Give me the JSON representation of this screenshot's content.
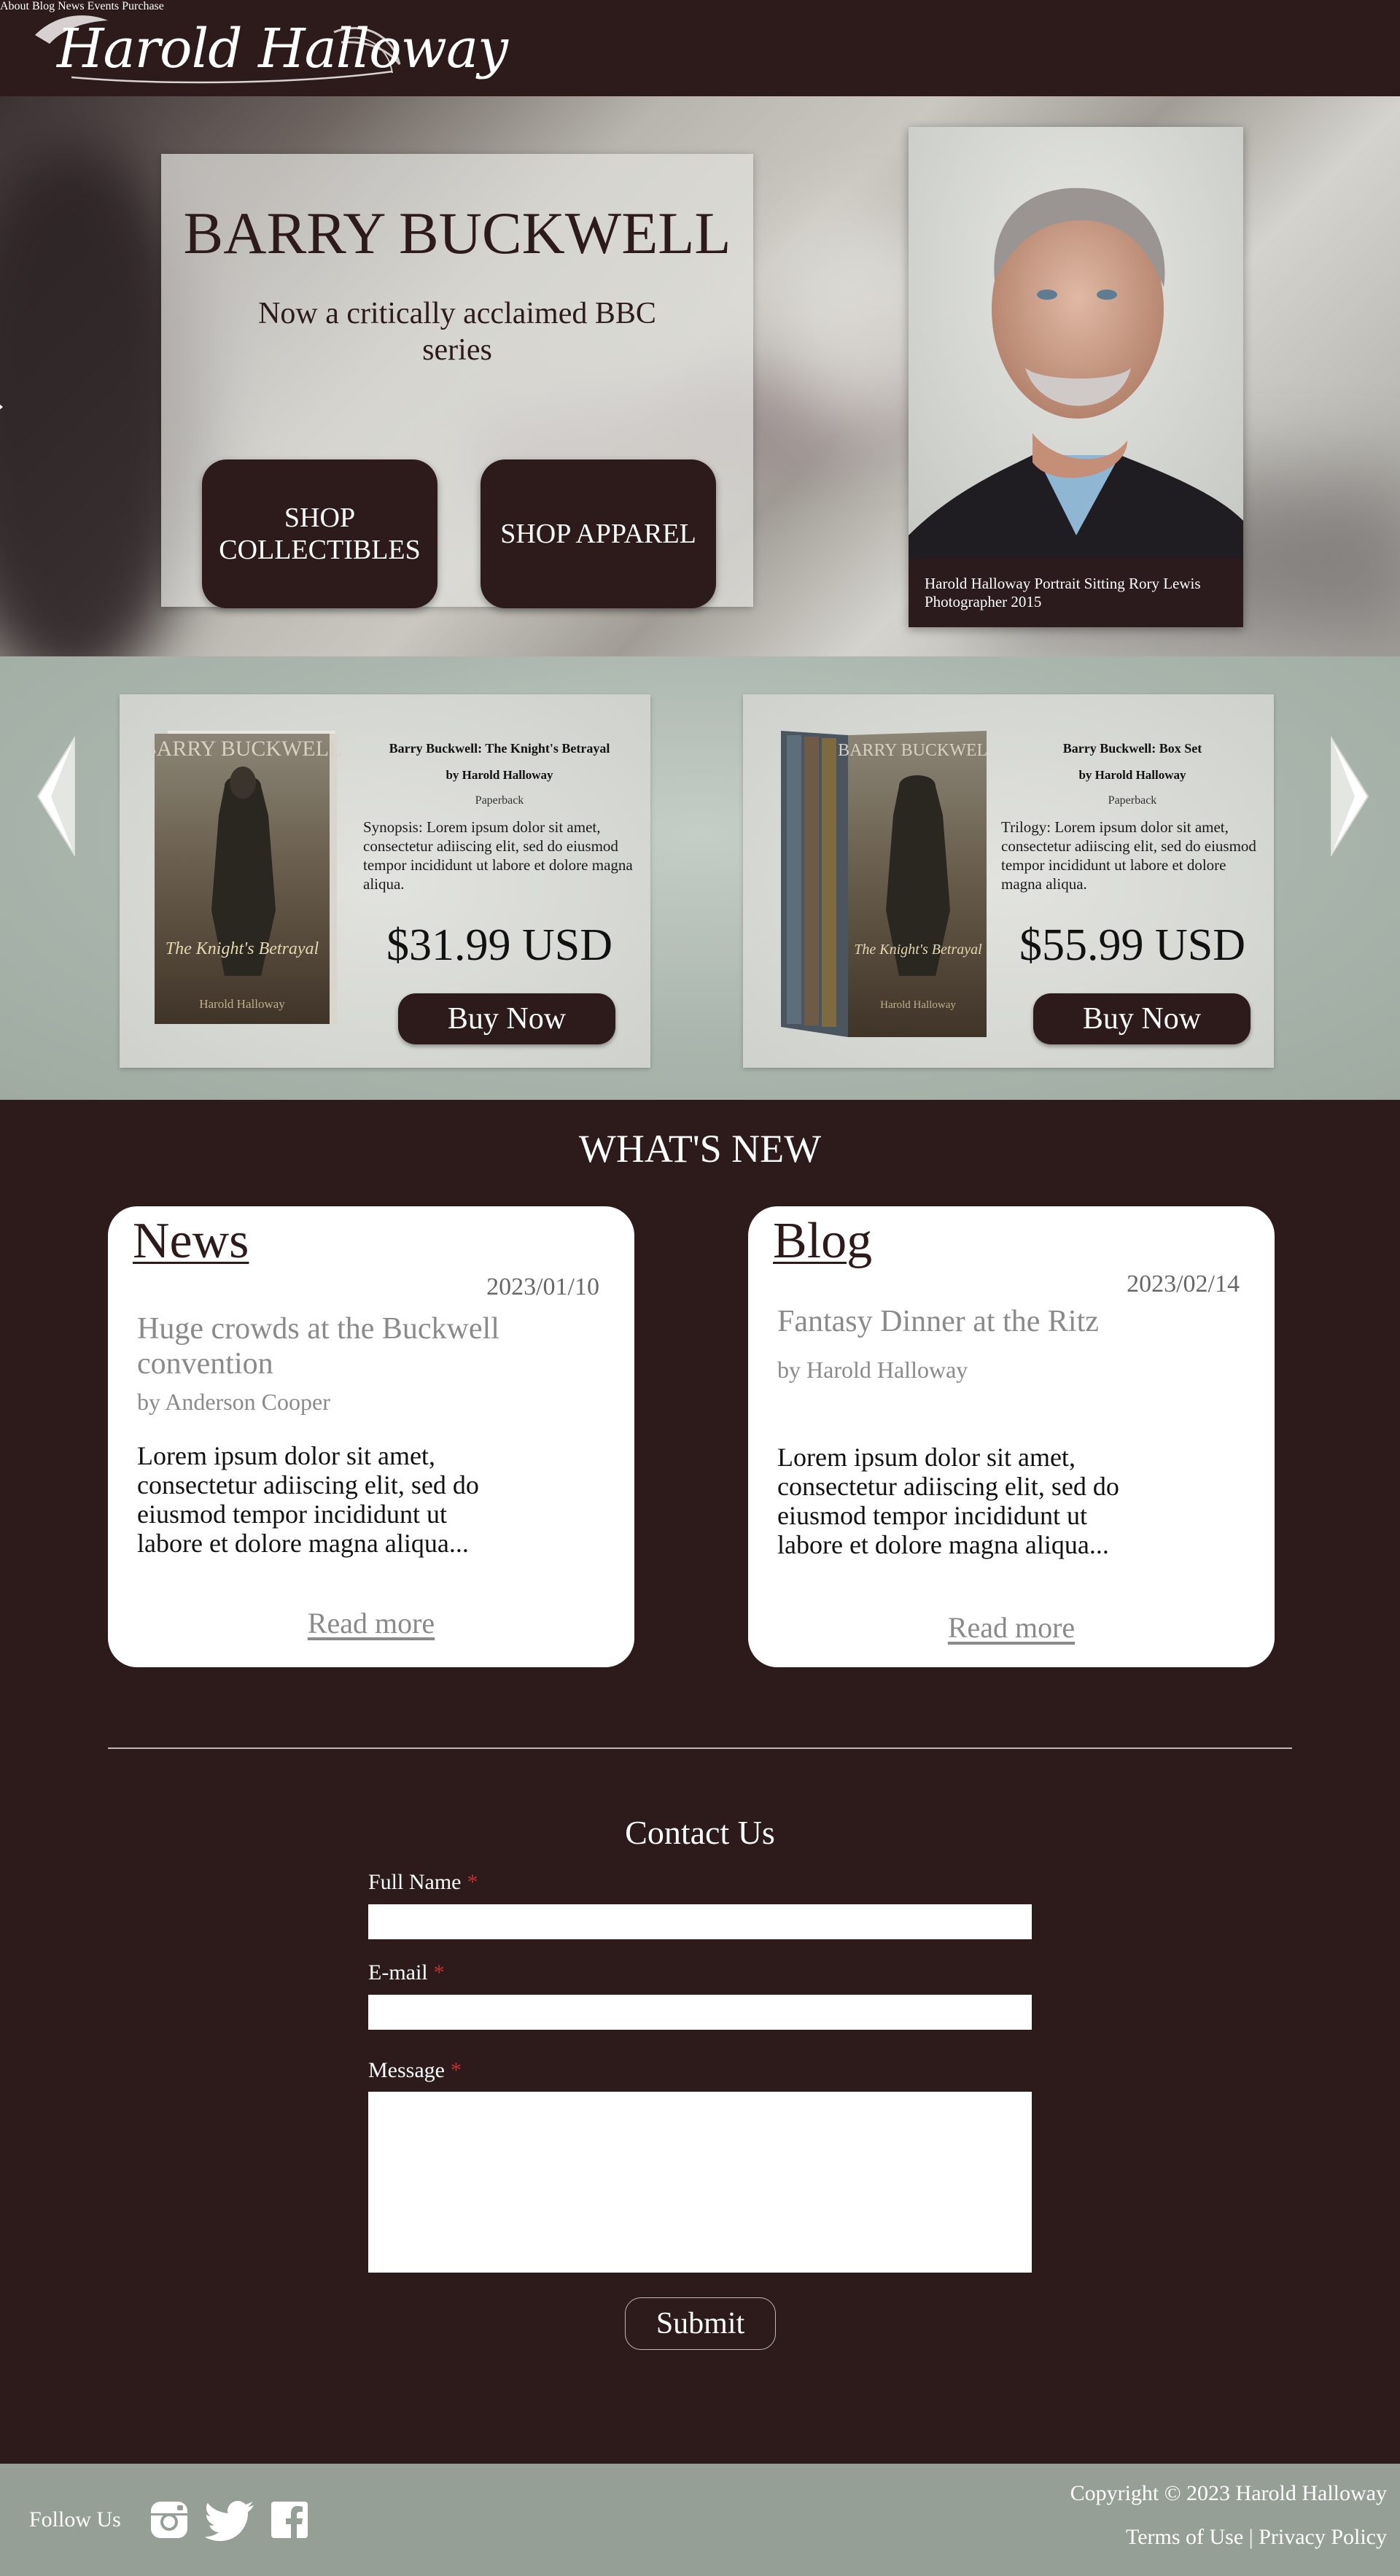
{
  "header": {
    "logo_text": "Harold Halloway",
    "nav": [
      "About",
      "Blog",
      "News",
      "Events",
      "Purchase"
    ]
  },
  "hero": {
    "title": "BARRY BUCKWELL",
    "subtitle": "Now a critically acclaimed BBC series",
    "shop_collectibles": "SHOP COLLECTIBLES",
    "shop_apparel": "SHOP APPAREL",
    "portrait_caption": "Harold Halloway Portrait Sitting Rory Lewis Photographer 2015"
  },
  "books": [
    {
      "cover_title": "BARRY BUCKWELL",
      "cover_subtitle": "The Knight's Betrayal",
      "cover_author": "Harold Halloway",
      "title": "Barry Buckwell: The Knight's Betrayal",
      "author": "by Harold Halloway",
      "format": "Paperback",
      "synopsis": "Synopsis: Lorem ipsum dolor sit amet, consectetur adiiscing elit, sed do eiusmod tempor incididunt ut labore et dolore magna aliqua.",
      "price": "$31.99 USD",
      "buy_label": "Buy Now"
    },
    {
      "cover_title": "BARRY BUCKWELL",
      "cover_subtitle": "The Knight's Betrayal",
      "cover_author": "Harold Halloway",
      "title": "Barry Buckwell: Box Set",
      "author": "by Harold Halloway",
      "format": "Paperback",
      "synopsis": "Trilogy: Lorem ipsum dolor sit amet, consectetur adiiscing elit, sed do eiusmod tempor incididunt ut labore et dolore magna aliqua.",
      "price": "$55.99 USD",
      "buy_label": "Buy Now"
    }
  ],
  "whats_new": {
    "heading": "WHAT'S NEW",
    "news": {
      "label": "News",
      "date": "2023/01/10",
      "headline": "Huge crowds at the Buckwell convention",
      "byline": "by Anderson Cooper",
      "excerpt": "Lorem ipsum dolor sit amet, consectetur adiiscing elit, sed do eiusmod tempor incididunt ut labore et dolore magna aliqua...",
      "read_more": "Read more"
    },
    "blog": {
      "label": "Blog",
      "date": "2023/02/14",
      "headline": "Fantasy Dinner at the Ritz",
      "byline": "by Harold Halloway",
      "excerpt": "Lorem ipsum dolor sit amet, consectetur adiiscing elit, sed do eiusmod tempor incididunt ut labore et dolore magna aliqua...",
      "read_more": "Read more"
    }
  },
  "contact": {
    "heading": "Contact Us",
    "full_name_label": "Full Name",
    "email_label": "E-mail",
    "message_label": "Message",
    "required_mark": "*",
    "submit_label": "Submit"
  },
  "footer": {
    "follow_label": "Follow Us",
    "copyright": "Copyright © 2023 Harold Halloway",
    "terms": "Terms of Use",
    "separator": "|",
    "privacy": "Privacy Policy"
  },
  "colors": {
    "primary_dark": "#2d1b1c",
    "footer_bg": "#969f95",
    "required": "#c0302f"
  }
}
